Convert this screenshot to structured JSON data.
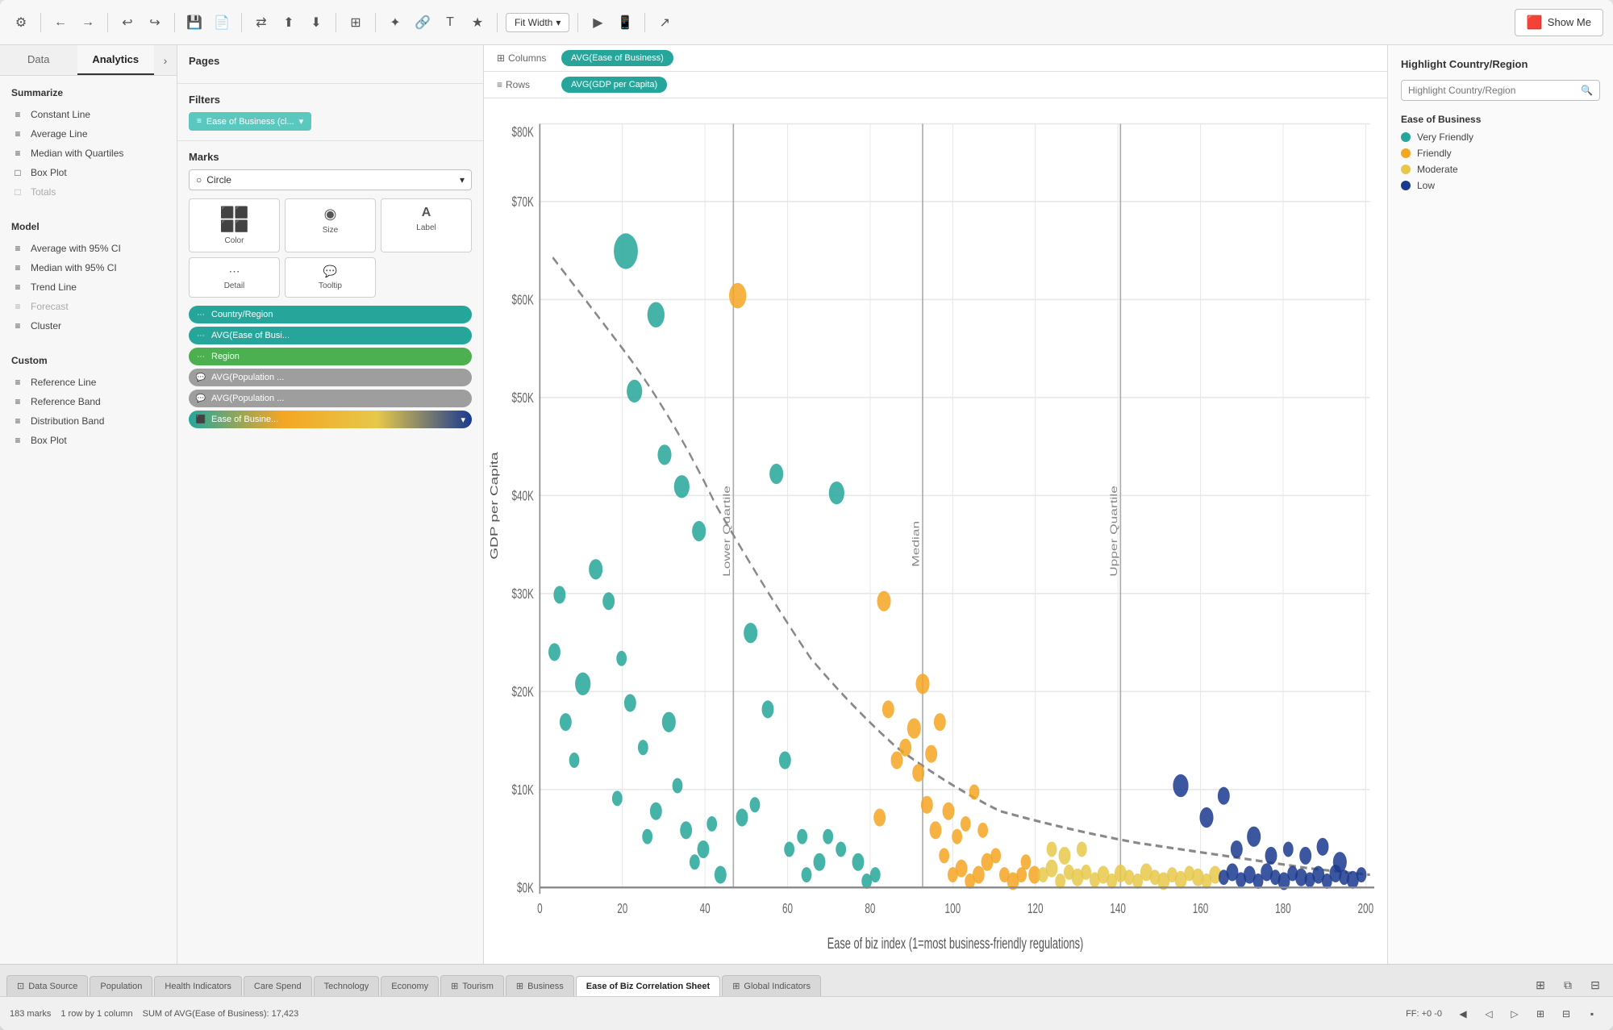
{
  "toolbar": {
    "fit_width_label": "Fit Width",
    "show_me_label": "Show Me"
  },
  "left_panel": {
    "tab_data": "Data",
    "tab_analytics": "Analytics",
    "summarize_title": "Summarize",
    "summarize_items": [
      {
        "label": "Constant Line",
        "icon": "≡"
      },
      {
        "label": "Average Line",
        "icon": "≡"
      },
      {
        "label": "Median with Quartiles",
        "icon": "≡"
      },
      {
        "label": "Box Plot",
        "icon": "□"
      },
      {
        "label": "Totals",
        "icon": "□"
      }
    ],
    "model_title": "Model",
    "model_items": [
      {
        "label": "Average with 95% CI",
        "icon": "≡"
      },
      {
        "label": "Median with 95% CI",
        "icon": "≡"
      },
      {
        "label": "Trend Line",
        "icon": "≡"
      },
      {
        "label": "Forecast",
        "icon": "≡",
        "disabled": true
      },
      {
        "label": "Cluster",
        "icon": "≡"
      }
    ],
    "custom_title": "Custom",
    "custom_items": [
      {
        "label": "Reference Line",
        "icon": "≡"
      },
      {
        "label": "Reference Band",
        "icon": "≡"
      },
      {
        "label": "Distribution Band",
        "icon": "≡"
      },
      {
        "label": "Box Plot",
        "icon": "≡"
      }
    ]
  },
  "center_panel": {
    "pages_title": "Pages",
    "filters_title": "Filters",
    "filter_label": "Ease of Business (cl...",
    "marks_title": "Marks",
    "marks_type": "Circle",
    "mark_buttons": [
      {
        "label": "Color",
        "icon": "⬛"
      },
      {
        "label": "Size",
        "icon": "◯"
      },
      {
        "label": "Label",
        "icon": "A"
      }
    ],
    "mark_buttons2": [
      {
        "label": "Detail",
        "icon": "⋯"
      },
      {
        "label": "Tooltip",
        "icon": "💬"
      }
    ],
    "mark_pills": [
      {
        "label": "Country/Region",
        "type": "dots",
        "color": "teal"
      },
      {
        "label": "AVG(Ease of Busi...",
        "type": "dots",
        "color": "teal"
      },
      {
        "label": "Region",
        "type": "dots",
        "color": "green"
      },
      {
        "label": "AVG(Population ...",
        "type": "chat",
        "color": "gray"
      },
      {
        "label": "AVG(Population ...",
        "type": "chat",
        "color": "gray"
      },
      {
        "label": "Ease of Busine...",
        "type": "multi",
        "color": "multicolor"
      }
    ]
  },
  "shelves": {
    "columns_label": "Columns",
    "columns_pill": "AVG(Ease of Business)",
    "rows_label": "Rows",
    "rows_pill": "AVG(GDP per Capita)"
  },
  "chart": {
    "x_axis_label": "Ease of biz index (1=most business-friendly regulations)",
    "y_axis_label": "GDP per Capita",
    "x_ticks": [
      "0",
      "20",
      "40",
      "60",
      "80",
      "100",
      "120",
      "140",
      "160",
      "180",
      "200"
    ],
    "y_ticks": [
      "$0K",
      "$10K",
      "$20K",
      "$30K",
      "$40K",
      "$50K",
      "$60K",
      "$70K",
      "$80K"
    ],
    "ref_lines": [
      {
        "label": "Lower Quartile",
        "x_pct": 30
      },
      {
        "label": "Median",
        "x_pct": 53
      },
      {
        "label": "Upper Quartile",
        "x_pct": 75
      }
    ]
  },
  "right_panel": {
    "title": "Highlight Country/Region",
    "search_placeholder": "Highlight Country/Region",
    "legend_title": "Ease of Business",
    "legend_items": [
      {
        "label": "Very Friendly",
        "color": "#26a69a"
      },
      {
        "label": "Friendly",
        "color": "#f5a623"
      },
      {
        "label": "Moderate",
        "color": "#e6c84a"
      },
      {
        "label": "Low",
        "color": "#1a3a8f"
      }
    ]
  },
  "status_bar": {
    "marks_count": "183 marks",
    "dimensions": "1 row by 1 column",
    "sum_label": "SUM of AVG(Ease of Business): 17,423",
    "right_label": "FF: +0 -0"
  },
  "tabs": [
    {
      "label": "Data Source",
      "icon": "⊞",
      "active": false
    },
    {
      "label": "Population",
      "icon": "",
      "active": false
    },
    {
      "label": "Health Indicators",
      "icon": "",
      "active": false
    },
    {
      "label": "Care Spend",
      "icon": "",
      "active": false
    },
    {
      "label": "Technology",
      "icon": "",
      "active": false
    },
    {
      "label": "Economy",
      "icon": "",
      "active": false
    },
    {
      "label": "Tourism",
      "icon": "⊞",
      "active": false
    },
    {
      "label": "Business",
      "icon": "⊞",
      "active": false
    },
    {
      "label": "Ease of Biz Correlation Sheet",
      "icon": "",
      "active": true
    },
    {
      "label": "Global Indicators",
      "icon": "⊞",
      "active": false
    }
  ]
}
